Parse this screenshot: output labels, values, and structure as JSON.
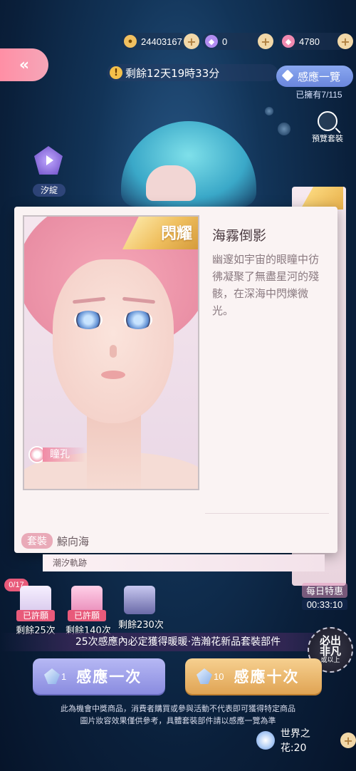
{
  "currency": {
    "gold": "24403167",
    "purple_gem": "0",
    "pink_gem": "4780"
  },
  "timer": {
    "text": "剩餘12天19時33分"
  },
  "overview": {
    "label": "感應一覽",
    "owned": "已擁有7/115"
  },
  "preview": {
    "label": "預覽套裝"
  },
  "character": {
    "name": "汐綻"
  },
  "card": {
    "badge": "閃耀",
    "part_label": "瞳孔",
    "title": "海霧倒影",
    "description": "幽邃如宇宙的眼瞳中彷彿凝聚了無盡星河的殘骸，在深海中閃爍微光。",
    "suit_badge": "套裝",
    "suit_name": "鯨向海",
    "sub_text": "潮汐軌跡",
    "back_badge": "閃耀"
  },
  "progress": {
    "counter": "0/17"
  },
  "rewards": [
    {
      "state": "已許願",
      "remain": "剩餘25次"
    },
    {
      "state": "已許願",
      "remain": "剩餘140次"
    },
    {
      "state": "",
      "remain": "剩餘230次"
    }
  ],
  "daily": {
    "label": "每日特惠",
    "countdown": "00:33:10"
  },
  "guarantee": {
    "text": "25次感應內必定獲得暖暖·浩瀚花新品套裝部件"
  },
  "seal": {
    "line1": "必出",
    "line2": "非凡",
    "line3": "或以上"
  },
  "draw_once": {
    "count": "1",
    "label": "感應一次"
  },
  "draw_ten": {
    "count": "10",
    "label": "感應十次"
  },
  "disclaimer": {
    "line1": "此為機會中獎商品，消費者購買或參與活動不代表即可獲得特定商品",
    "line2": "圖片妝容效果僅供參考，具體套裝部件請以感應一覽為準"
  },
  "world_flower": {
    "text": "世界之花:20"
  },
  "colors": {
    "accent_pink": "#e85a7a",
    "button_violet": "#8a8ce0",
    "button_gold": "#e0a454"
  }
}
